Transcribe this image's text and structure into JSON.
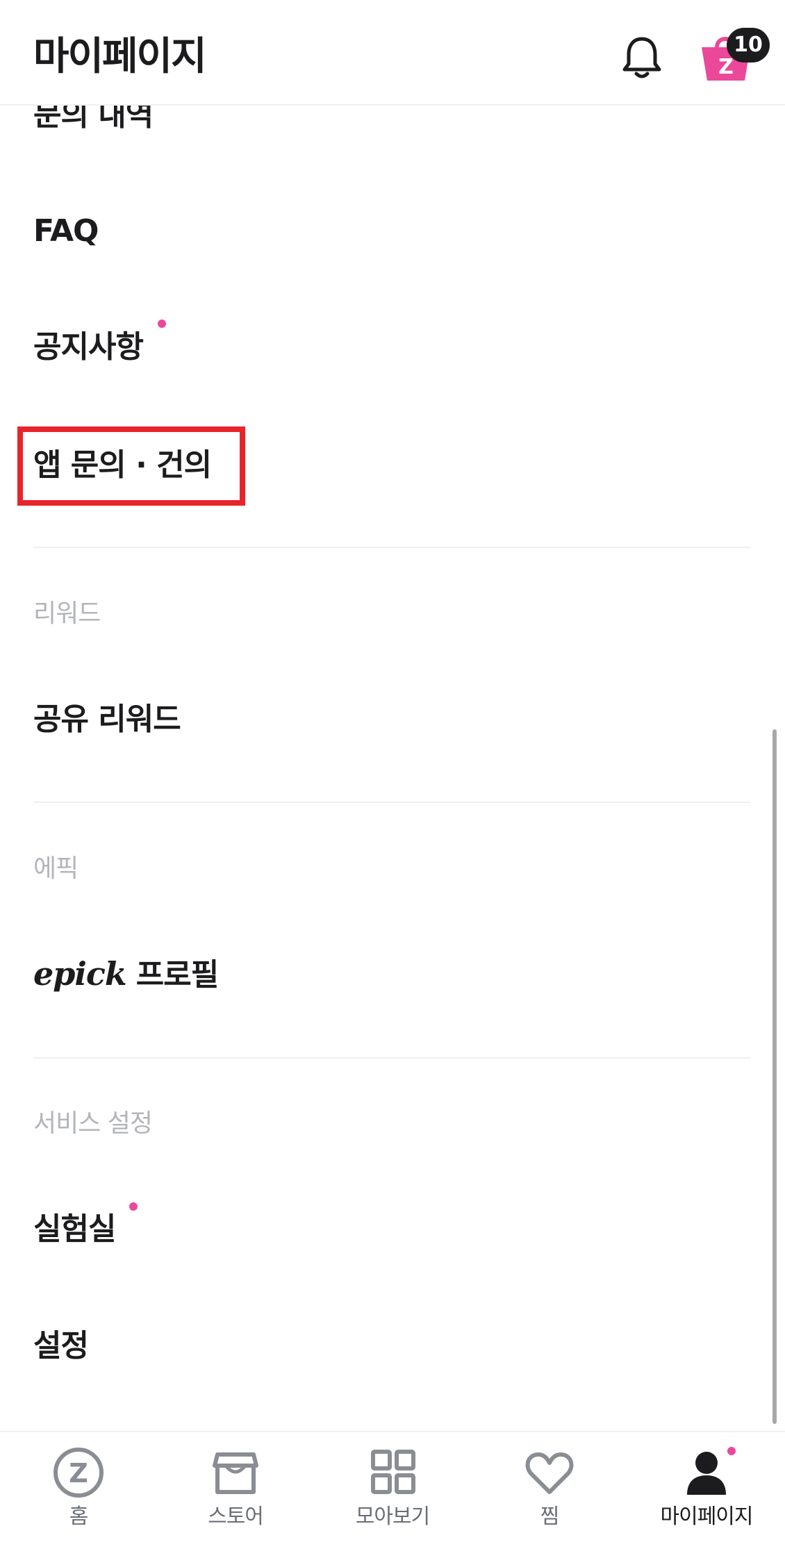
{
  "header": {
    "title": "마이페이지",
    "bell_icon": "bell-icon",
    "cart_icon": "shopping-bag-icon",
    "cart_count": "10",
    "accent_color": "#EC4899"
  },
  "menu": {
    "partial_item": "문의 내역",
    "faq": "FAQ",
    "notice": "공지사항",
    "app_inquiry": "앱 문의 · 건의",
    "reward_section": "리워드",
    "share_reward": "공유 리워드",
    "epick_section": "에픽",
    "epick_logo": "epick",
    "epick_profile": "프로필",
    "service_section": "서비스 설정",
    "lab": "실험실",
    "settings": "설정"
  },
  "highlight": {
    "color": "#E8242B",
    "target": "app_inquiry"
  },
  "bottom_nav": {
    "items": [
      {
        "label": "홈",
        "icon": "zigzag-home-icon"
      },
      {
        "label": "스토어",
        "icon": "store-icon"
      },
      {
        "label": "모아보기",
        "icon": "grid-icon"
      },
      {
        "label": "찜",
        "icon": "heart-icon"
      },
      {
        "label": "마이페이지",
        "icon": "person-icon",
        "active": true
      }
    ]
  }
}
